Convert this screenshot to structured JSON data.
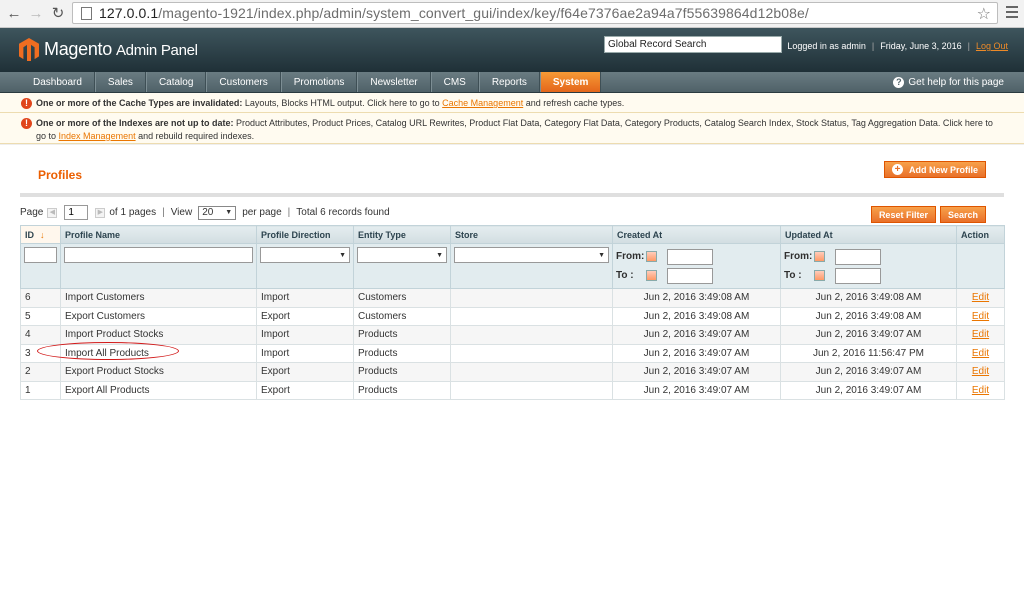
{
  "browser": {
    "url_host": "127.0.0.1",
    "url_path": "/magento-1921/index.php/admin/system_convert_gui/index/key/f64e7376ae2a94a7f55639864d12b08e/"
  },
  "header": {
    "logo_brand": "Magento",
    "logo_sub": "Admin Panel",
    "global_search_placeholder": "Global Record Search",
    "logged_in": "Logged in as admin",
    "date": "Friday, June 3, 2016",
    "logout": "Log Out"
  },
  "nav": {
    "items": [
      "Dashboard",
      "Sales",
      "Catalog",
      "Customers",
      "Promotions",
      "Newsletter",
      "CMS",
      "Reports",
      "System"
    ],
    "active": "System",
    "help": "Get help for this page"
  },
  "messages": {
    "cache": {
      "bold": "One or more of the Cache Types are invalidated:",
      "text": " Layouts, Blocks HTML output. Click here to go to ",
      "link": "Cache Management",
      "after": " and refresh cache types."
    },
    "index": {
      "bold": "One or more of the Indexes are not up to date:",
      "text": " Product Attributes, Product Prices, Catalog URL Rewrites, Product Flat Data, Category Flat Data, Category Products, Catalog Search Index, Stock Status, Tag Aggregation Data. Click here to go to ",
      "link": "Index Management",
      "after": " and rebuild required indexes."
    }
  },
  "page": {
    "title": "Profiles",
    "add_button": "Add New Profile"
  },
  "pager": {
    "page_label": "Page",
    "page_value": "1",
    "of_pages": "of 1 pages",
    "view_label": "View",
    "per_page_value": "20",
    "per_page_label": "per page",
    "total": "Total 6 records found",
    "reset_filter": "Reset Filter",
    "search": "Search"
  },
  "grid": {
    "columns": [
      "ID",
      "Profile Name",
      "Profile Direction",
      "Entity Type",
      "Store",
      "Created At",
      "Updated At",
      "Action"
    ],
    "from_label": "From:",
    "to_label": "To :",
    "rows": [
      {
        "id": "6",
        "name": "Import Customers",
        "direction": "Import",
        "entity": "Customers",
        "store": "",
        "created": "Jun 2, 2016 3:49:08 AM",
        "updated": "Jun 2, 2016 3:49:08 AM",
        "action": "Edit"
      },
      {
        "id": "5",
        "name": "Export Customers",
        "direction": "Export",
        "entity": "Customers",
        "store": "",
        "created": "Jun 2, 2016 3:49:08 AM",
        "updated": "Jun 2, 2016 3:49:08 AM",
        "action": "Edit"
      },
      {
        "id": "4",
        "name": "Import Product Stocks",
        "direction": "Import",
        "entity": "Products",
        "store": "",
        "created": "Jun 2, 2016 3:49:07 AM",
        "updated": "Jun 2, 2016 3:49:07 AM",
        "action": "Edit"
      },
      {
        "id": "3",
        "name": "Import All Products",
        "direction": "Import",
        "entity": "Products",
        "store": "",
        "created": "Jun 2, 2016 3:49:07 AM",
        "updated": "Jun 2, 2016 11:56:47 PM",
        "action": "Edit"
      },
      {
        "id": "2",
        "name": "Export Product Stocks",
        "direction": "Export",
        "entity": "Products",
        "store": "",
        "created": "Jun 2, 2016 3:49:07 AM",
        "updated": "Jun 2, 2016 3:49:07 AM",
        "action": "Edit"
      },
      {
        "id": "1",
        "name": "Export All Products",
        "direction": "Export",
        "entity": "Products",
        "store": "",
        "created": "Jun 2, 2016 3:49:07 AM",
        "updated": "Jun 2, 2016 3:49:07 AM",
        "action": "Edit"
      }
    ]
  },
  "colors": {
    "accent": "#eb5e00",
    "header_bg": "#2b3f46",
    "nav_active": "#f08a2c",
    "highlight_circle": "#d21a1a"
  }
}
